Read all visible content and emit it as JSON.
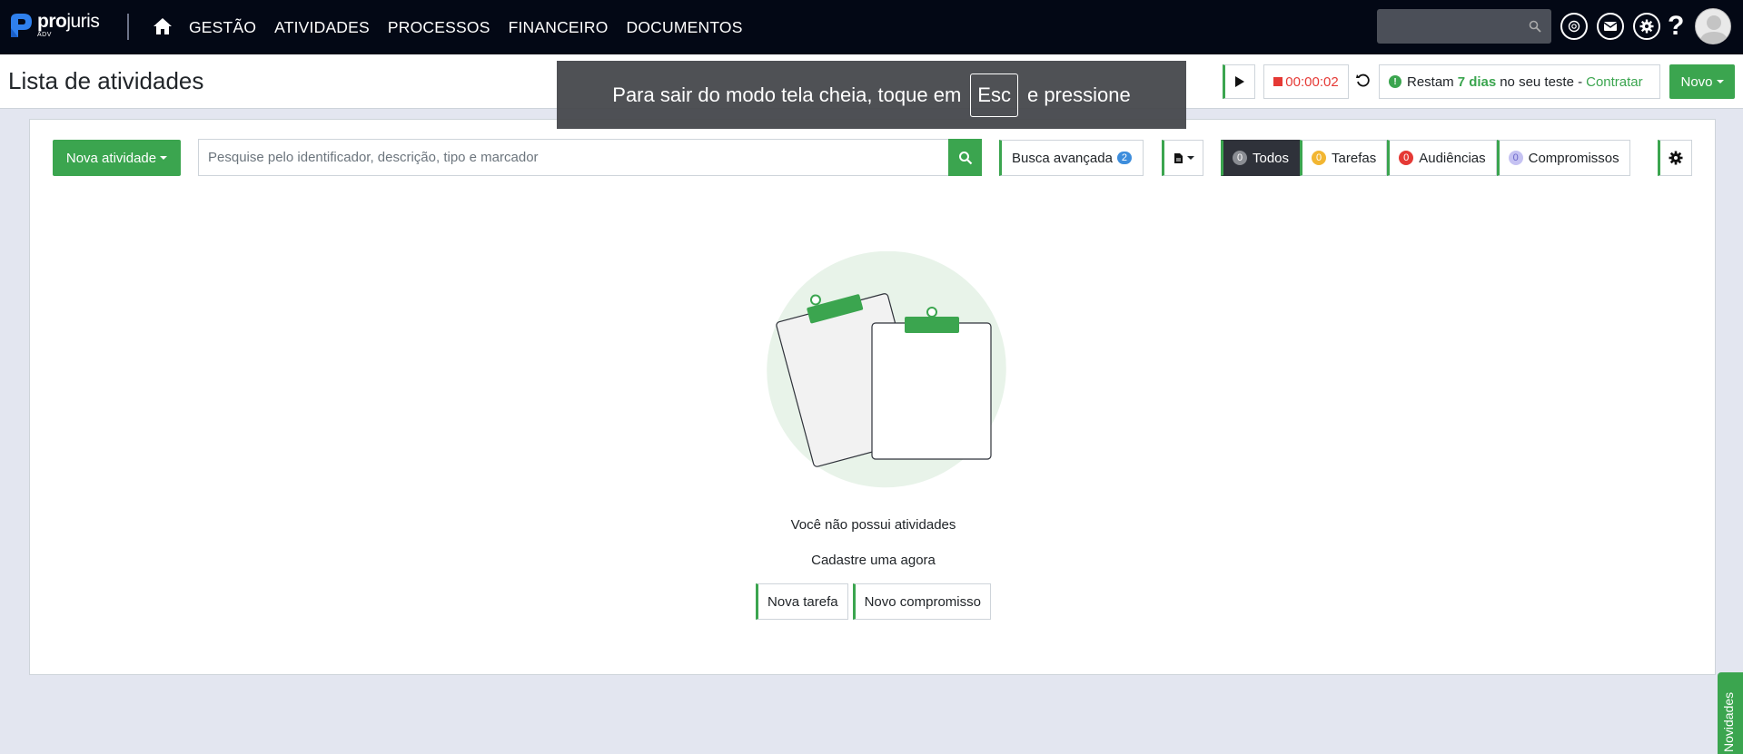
{
  "app": {
    "logo_name_bold": "pro",
    "logo_name_light": "juris",
    "logo_sub": "ADV"
  },
  "nav": {
    "items": [
      "GESTÃO",
      "ATIVIDADES",
      "PROCESSOS",
      "FINANCEIRO",
      "DOCUMENTOS"
    ]
  },
  "subheader": {
    "title": "Lista de atividades",
    "timer": "00:00:02",
    "trial_prefix": "Restam",
    "trial_days": "7 dias",
    "trial_suffix": "no seu teste -",
    "trial_link": "Contratar",
    "new_label": "Novo"
  },
  "fullscreen_notice": {
    "before": "Para sair do modo tela cheia, toque em",
    "key": "Esc",
    "after": "e pressione"
  },
  "toolbar": {
    "new_activity": "Nova atividade",
    "search_placeholder": "Pesquise pelo identificador, descrição, tipo e marcador",
    "advanced_search": "Busca avançada",
    "advanced_badge": "2",
    "filters": [
      {
        "label": "Todos",
        "count": "0",
        "color": "#8a8d93"
      },
      {
        "label": "Tarefas",
        "count": "0",
        "color": "#f2b632"
      },
      {
        "label": "Audiências",
        "count": "0",
        "color": "#e53935"
      },
      {
        "label": "Compromissos",
        "count": "0",
        "color": "#c5c2f2"
      }
    ]
  },
  "empty_state": {
    "title": "Você não possui atividades",
    "subtitle": "Cadastre uma agora",
    "new_task": "Nova tarefa",
    "new_appointment": "Novo compromisso"
  },
  "side_tab": {
    "label": "Novidades"
  },
  "colors": {
    "brand_green": "#3ba54f",
    "navbar_bg": "#030815",
    "timer_red": "#e53935"
  }
}
